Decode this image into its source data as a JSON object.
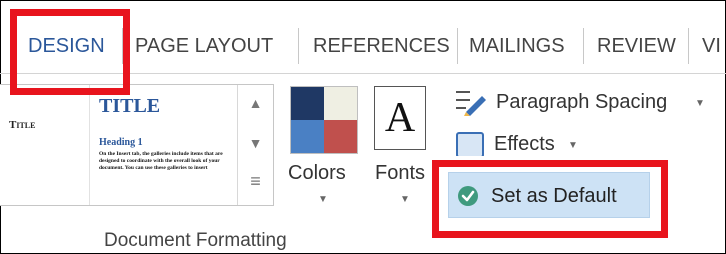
{
  "tabs": [
    {
      "label": "DESIGN",
      "active": true
    },
    {
      "label": "PAGE LAYOUT",
      "active": false
    },
    {
      "label": "REFERENCES",
      "active": false
    },
    {
      "label": "MAILINGS",
      "active": false
    },
    {
      "label": "REVIEW",
      "active": false
    },
    {
      "label": "VI",
      "active": false
    }
  ],
  "gallery": {
    "thumb1_title": "Title",
    "thumb2_title": "TITLE",
    "thumb2_heading": "Heading 1",
    "thumb2_body": "On the Insert tab, the galleries include items that are designed to coordinate with the overall look of your document. You can use these galleries to insert"
  },
  "colors_label": "Colors",
  "fonts_label": "Fonts",
  "fonts_glyph": "A",
  "paragraph_spacing_label": "Paragraph Spacing",
  "effects_label": "Effects",
  "set_default_label": "Set as Default",
  "group_label": "Document Formatting",
  "theme_colors": [
    "#1f3864",
    "#efefe3",
    "#4a80c4",
    "#c0504d"
  ],
  "accent_color": "#2b579a",
  "highlight_color": "#e8141d"
}
